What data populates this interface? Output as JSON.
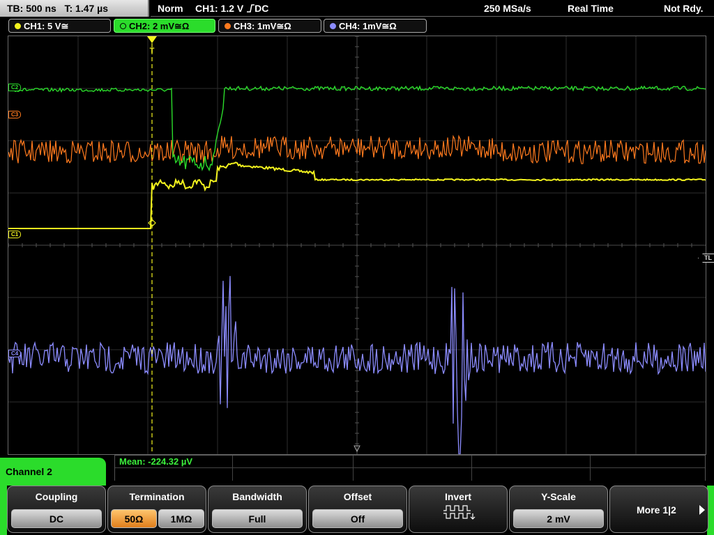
{
  "status": {
    "timebase": "TB: 500 ns",
    "trigger_time": "T: 1.47 µs",
    "mode": "Norm",
    "trigger_source": "CH1: 1.2 V",
    "trigger_slope_icon": "rising-edge-icon",
    "trigger_coupling": "DC",
    "sample_rate": "250 MSa/s",
    "acq_mode": "Real Time",
    "ready_state": "Not Rdy."
  },
  "channels": [
    {
      "label": "CH1: 5 V≅",
      "color": "#f4f41e"
    },
    {
      "label": "CH2: 2 mV≅Ω",
      "color": "#2bdc2b"
    },
    {
      "label": "CH3: 1mV≅Ω",
      "color": "#ff7a1e"
    },
    {
      "label": "CH4: 1mV≅Ω",
      "color": "#8c8cff"
    }
  ],
  "markers": {
    "c2": "C2",
    "c3": "C3",
    "c1": "C1",
    "c4": "C4",
    "trigger_level": "TL",
    "trigger_pos": "T"
  },
  "measurement": {
    "mean": "Mean: -224.32 µV"
  },
  "menu": {
    "channel_title": "Channel 2",
    "coupling": {
      "title": "Coupling",
      "value": "DC"
    },
    "termination": {
      "title": "Termination",
      "option_a": "50Ω",
      "option_b": "1MΩ",
      "selected": "50Ω"
    },
    "bandwidth": {
      "title": "Bandwidth",
      "value": "Full"
    },
    "offset": {
      "title": "Offset",
      "value": "Off"
    },
    "invert": {
      "title": "Invert",
      "icon": "invert-waveform-icon"
    },
    "yscale": {
      "title": "Y-Scale",
      "value": "2 mV"
    },
    "more": {
      "label": "More 1|2",
      "icon": "chevron-right-icon"
    }
  }
}
